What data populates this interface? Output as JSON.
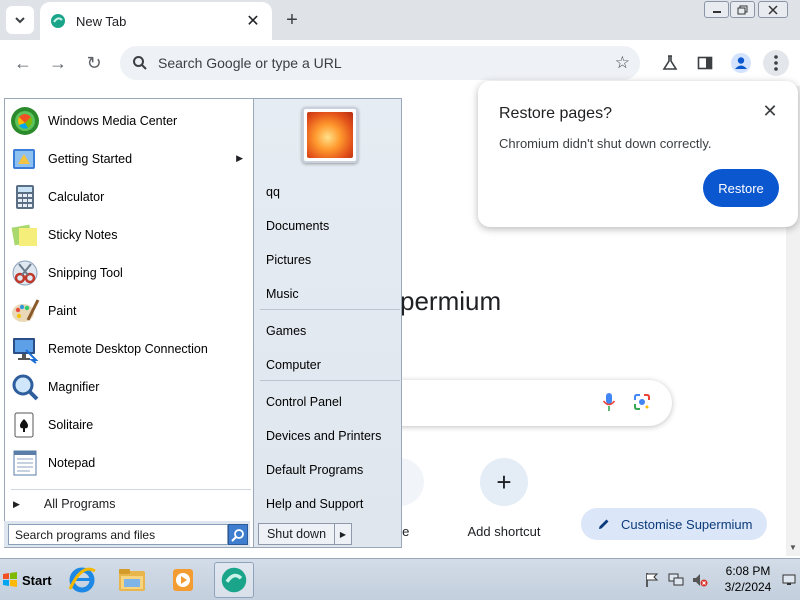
{
  "browser": {
    "tab": {
      "title": "New Tab"
    },
    "omnibox": {
      "placeholder": "Search Google or type a URL"
    },
    "window_controls": [
      "minimize",
      "restore",
      "close"
    ]
  },
  "page": {
    "brand_fragment": "permium",
    "shortcuts": [
      {
        "label": "ore"
      },
      {
        "label": "Add shortcut",
        "icon": "+"
      }
    ],
    "customise_label": "Customise Supermium"
  },
  "restore_popup": {
    "title": "Restore pages?",
    "message": "Chromium didn't shut down correctly.",
    "button": "Restore"
  },
  "start_menu": {
    "programs": [
      {
        "label": "Windows Media Center",
        "icon": "windows-media-center-icon"
      },
      {
        "label": "Getting Started",
        "icon": "getting-started-icon",
        "submenu": true
      },
      {
        "label": "Calculator",
        "icon": "calculator-icon"
      },
      {
        "label": "Sticky Notes",
        "icon": "sticky-notes-icon"
      },
      {
        "label": "Snipping Tool",
        "icon": "snipping-tool-icon"
      },
      {
        "label": "Paint",
        "icon": "paint-icon"
      },
      {
        "label": "Remote Desktop Connection",
        "icon": "remote-desktop-icon"
      },
      {
        "label": "Magnifier",
        "icon": "magnifier-icon"
      },
      {
        "label": "Solitaire",
        "icon": "solitaire-icon"
      },
      {
        "label": "Notepad",
        "icon": "notepad-icon"
      }
    ],
    "all_programs": "All Programs",
    "search_placeholder": "Search programs and files",
    "right_items": {
      "user": "qq",
      "documents": "Documents",
      "pictures": "Pictures",
      "music": "Music",
      "games": "Games",
      "computer": "Computer",
      "control_panel": "Control Panel",
      "devices": "Devices and Printers",
      "default_programs": "Default Programs",
      "help": "Help and Support"
    },
    "shutdown": "Shut down"
  },
  "taskbar": {
    "start_label": "Start",
    "apps": [
      "internet-explorer-icon",
      "windows-explorer-icon",
      "media-player-icon",
      "supermium-icon"
    ],
    "clock": {
      "time": "6:08 PM",
      "date": "3/2/2024"
    }
  },
  "colors": {
    "accent": "#0b57d0",
    "tabstrip": "#dfe3e8",
    "taskbar": "#c3cfdd"
  }
}
